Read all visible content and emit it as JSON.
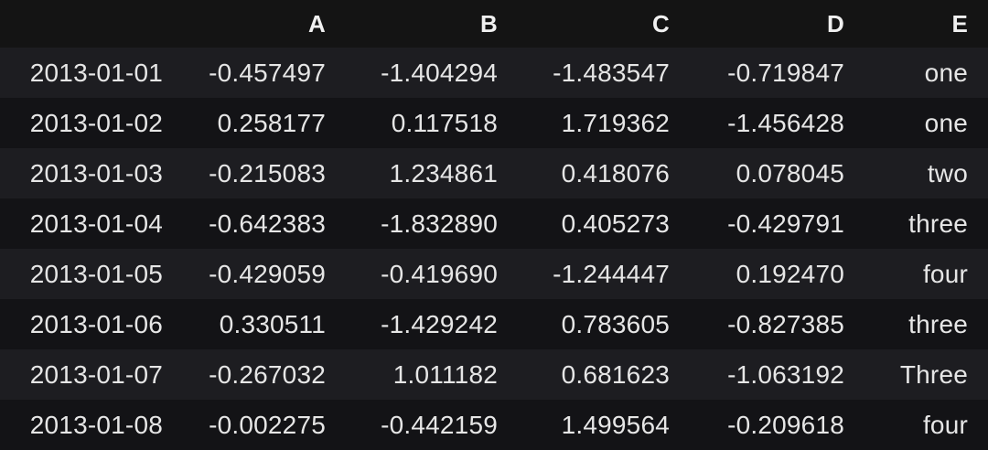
{
  "table": {
    "index_header": "",
    "columns": [
      "A",
      "B",
      "C",
      "D",
      "E"
    ],
    "rows": [
      {
        "index": "2013-01-01",
        "cells": [
          "-0.457497",
          "-1.404294",
          "-1.483547",
          "-0.719847",
          "one"
        ]
      },
      {
        "index": "2013-01-02",
        "cells": [
          "0.258177",
          "0.117518",
          "1.719362",
          "-1.456428",
          "one"
        ]
      },
      {
        "index": "2013-01-03",
        "cells": [
          "-0.215083",
          "1.234861",
          "0.418076",
          "0.078045",
          "two"
        ]
      },
      {
        "index": "2013-01-04",
        "cells": [
          "-0.642383",
          "-1.832890",
          "0.405273",
          "-0.429791",
          "three"
        ]
      },
      {
        "index": "2013-01-05",
        "cells": [
          "-0.429059",
          "-0.419690",
          "-1.244447",
          "0.192470",
          "four"
        ]
      },
      {
        "index": "2013-01-06",
        "cells": [
          "0.330511",
          "-1.429242",
          "0.783605",
          "-0.827385",
          "three"
        ]
      },
      {
        "index": "2013-01-07",
        "cells": [
          "-0.267032",
          "1.011182",
          "0.681623",
          "-1.063192",
          "Three"
        ]
      },
      {
        "index": "2013-01-08",
        "cells": [
          "-0.002275",
          "-0.442159",
          "1.499564",
          "-0.209618",
          "four"
        ]
      }
    ]
  },
  "colors": {
    "background": "#111111",
    "row_odd": "#1d1d21",
    "row_even": "#131316",
    "text": "#e6e6e6"
  }
}
